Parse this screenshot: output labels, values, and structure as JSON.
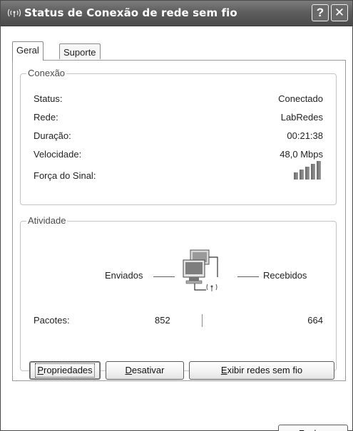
{
  "window": {
    "title": "Status de Conexão de rede sem fio",
    "title_icon": "wireless-signal-icon",
    "help_glyph": "?",
    "close_glyph": "✕"
  },
  "tabs": [
    {
      "label": "Geral",
      "active": true
    },
    {
      "label": "Suporte",
      "active": false
    }
  ],
  "conexao": {
    "legend": "Conexão",
    "rows": [
      {
        "label": "Status:",
        "value": "Conectado"
      },
      {
        "label": "Rede:",
        "value": "LabRedes"
      },
      {
        "label": "Duração:",
        "value": "00:21:38"
      },
      {
        "label": "Velocidade:",
        "value": "48,0 Mbps"
      }
    ],
    "signal_label": "Força do Sinal:",
    "signal_bars_filled": 5,
    "signal_bars_total": 5
  },
  "atividade": {
    "legend": "Atividade",
    "sent_label": "Enviados",
    "received_label": "Recebidos",
    "icon": "network-computers-icon",
    "packets_label": "Pacotes:",
    "packets_sent": "852",
    "packets_received": "664"
  },
  "buttons": {
    "propriedades": {
      "mnemonic": "P",
      "rest": "ropriedades"
    },
    "desativar": {
      "mnemonic": "D",
      "rest": "esativar"
    },
    "exibir": {
      "mnemonic": "E",
      "rest": "xibir redes sem fio"
    },
    "fechar": {
      "mnemonic": "F",
      "rest": "echar"
    }
  }
}
